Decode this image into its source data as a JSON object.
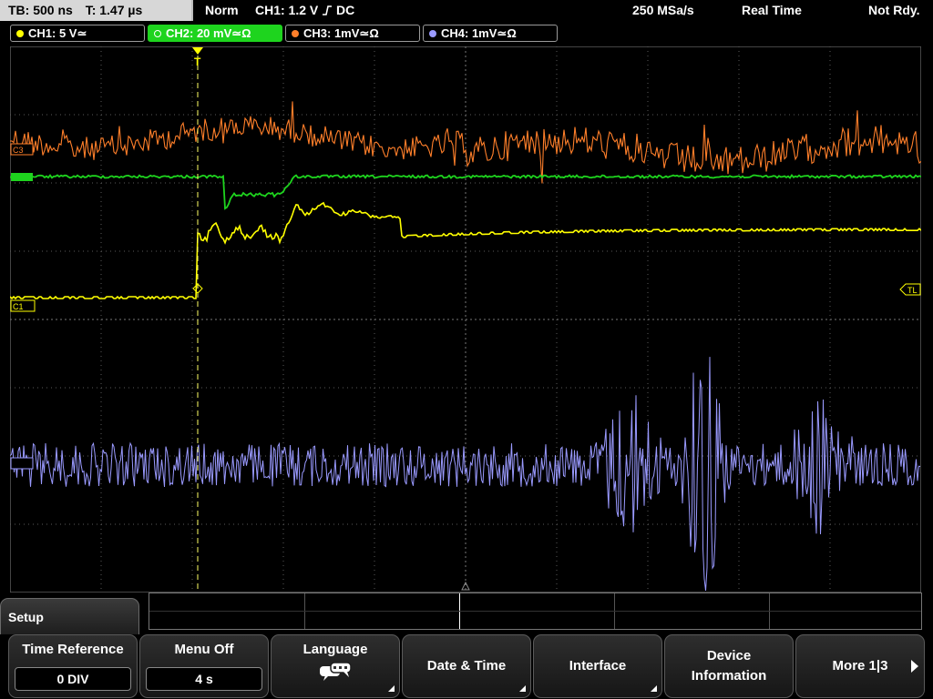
{
  "status": {
    "timebase": "TB: 500 ns",
    "trigger_time": "T: 1.47 µs",
    "mode": "Norm",
    "trigger_source": "CH1: 1.2 V",
    "trigger_coupling": "DC",
    "sample_rate": "250 MSa/s",
    "acquisition": "Real Time",
    "ready_state": "Not Rdy."
  },
  "channels": [
    {
      "label": "CH1: 5 V",
      "suffix": "≃",
      "color": "#ffff00",
      "active": false
    },
    {
      "label": "CH2: 20 mV",
      "suffix": "≃Ω",
      "color": "#00ff00",
      "active": true
    },
    {
      "label": "CH3: 1mV",
      "suffix": "≃Ω",
      "color": "#ff8c1a",
      "active": false
    },
    {
      "label": "CH4: 1mV",
      "suffix": "≃Ω",
      "color": "#9999ff",
      "active": false
    }
  ],
  "markers": {
    "ch1": "C1",
    "ch3": "C3",
    "trigger_level": "TL",
    "trigger_pos": "T"
  },
  "menu": {
    "title": "Setup",
    "time_reference_label": "Time Reference",
    "time_reference_value": "0 DIV",
    "menu_off_label": "Menu Off",
    "menu_off_value": "4 s",
    "language_label": "Language",
    "date_time_label": "Date & Time",
    "interface_label": "Interface",
    "device_info_line1": "Device",
    "device_info_line2": "Information",
    "more_label": "More 1|3"
  },
  "colors": {
    "ch1": "#ffff00",
    "ch2": "#1ed41e",
    "ch3": "#ff7f2a",
    "ch4": "#9a9aff",
    "grid": "#5a5a5a",
    "tab_active": "#1ed41e"
  }
}
